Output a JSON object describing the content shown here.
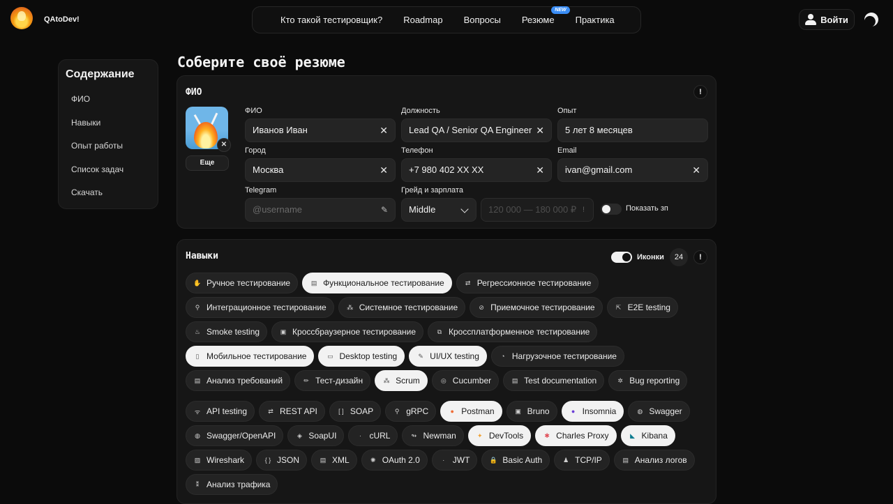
{
  "brand": "QAtoDev!",
  "nav": [
    {
      "label": "Кто такой тестировщик?"
    },
    {
      "label": "Roadmap"
    },
    {
      "label": "Вопросы"
    },
    {
      "label": "Резюме",
      "badge": "NEW"
    },
    {
      "label": "Практика"
    }
  ],
  "login_label": "Войти",
  "sidebar": {
    "title": "Содержание",
    "items": [
      "ФИО",
      "Навыки",
      "Опыт работы",
      "Список задач",
      "Скачать"
    ]
  },
  "page_title": "Соберите своё резюме",
  "fio": {
    "title": "ФИО",
    "info": "!",
    "more_label": "Еще",
    "avatar_remove": "✕",
    "fields": {
      "name": {
        "label": "ФИО",
        "value": "Иванов Иван"
      },
      "position": {
        "label": "Должность",
        "value": "Lead QA / Senior QA Engineer"
      },
      "experience": {
        "label": "Опыт",
        "value": "5 лет 8 месяцев"
      },
      "city": {
        "label": "Город",
        "value": "Москва"
      },
      "phone": {
        "label": "Телефон",
        "value": "+7 980 402 XX XX"
      },
      "email": {
        "label": "Email",
        "value": "ivan@gmail.com"
      },
      "telegram": {
        "label": "Telegram",
        "placeholder": "@username"
      },
      "grade": {
        "label": "Грейд и зарплата",
        "value": "Middle"
      },
      "salary": {
        "placeholder": "120 000 — 180 000 ₽"
      }
    },
    "show_salary_label": "Показать зп",
    "show_salary": false
  },
  "skills": {
    "title": "Навыки",
    "icons_label": "Иконки",
    "icons_on": true,
    "count": "24",
    "info": "!",
    "rows_a": [
      [
        {
          "label": "Ручное тестирование",
          "icon": "✋",
          "selected": false
        },
        {
          "label": "Функциональное тестирование",
          "icon": "▤",
          "selected": true
        },
        {
          "label": "Регрессионное тестирование",
          "icon": "⇄",
          "selected": false
        }
      ],
      [
        {
          "label": "Интеграционное тестирование",
          "icon": "⚲",
          "selected": false
        },
        {
          "label": "Системное тестирование",
          "icon": "⁂",
          "selected": false
        },
        {
          "label": "Приемочное тестирование",
          "icon": "⊘",
          "selected": false
        },
        {
          "label": "E2E testing",
          "icon": "⇱",
          "selected": false
        }
      ],
      [
        {
          "label": "Smoke testing",
          "icon": "♨",
          "selected": false
        },
        {
          "label": "Кроссбраузерное тестирование",
          "icon": "▣",
          "selected": false
        },
        {
          "label": "Кроссплатформенное тестирование",
          "icon": "⧉",
          "selected": false
        }
      ],
      [
        {
          "label": "Мобильное тестирование",
          "icon": "▯",
          "selected": true
        },
        {
          "label": "Desktop testing",
          "icon": "▭",
          "selected": true
        },
        {
          "label": "UI/UX testing",
          "icon": "✎",
          "selected": true
        },
        {
          "label": "Нагрузочное тестирование",
          "icon": "◔",
          "selected": false
        }
      ],
      [
        {
          "label": "Анализ требований",
          "icon": "▤",
          "selected": false
        },
        {
          "label": "Тест-дизайн",
          "icon": "✏",
          "selected": false
        },
        {
          "label": "Scrum",
          "icon": "⁂",
          "selected": true
        },
        {
          "label": "Cucumber",
          "icon": "◎",
          "selected": false
        },
        {
          "label": "Test documentation",
          "icon": "▤",
          "selected": false
        },
        {
          "label": "Bug reporting",
          "icon": "✲",
          "selected": false
        }
      ]
    ],
    "rows_b": [
      [
        {
          "label": "API testing",
          "icon": "ᯤ",
          "selected": false
        },
        {
          "label": "REST API",
          "icon": "⇄",
          "selected": false
        },
        {
          "label": "SOAP",
          "icon": "[ ]",
          "selected": false
        },
        {
          "label": "gRPC",
          "icon": "⚲",
          "selected": false
        },
        {
          "label": "Postman",
          "icon": "●",
          "selected": true,
          "color": "#ef6c35"
        },
        {
          "label": "Bruno",
          "icon": "▣",
          "selected": false
        },
        {
          "label": "Insomnia",
          "icon": "●",
          "selected": true,
          "color": "#6b3fd6"
        },
        {
          "label": "Swagger",
          "icon": "◍",
          "selected": false
        }
      ],
      [
        {
          "label": "Swagger/OpenAPI",
          "icon": "◍",
          "selected": false
        },
        {
          "label": "SoapUI",
          "icon": "◈",
          "selected": false
        },
        {
          "label": "cURL",
          "icon": "·",
          "selected": false
        },
        {
          "label": "Newman",
          "icon": "↬",
          "selected": false
        },
        {
          "label": "DevTools",
          "icon": "✦",
          "selected": true,
          "color": "#f0a030"
        },
        {
          "label": "Charles Proxy",
          "icon": "✱",
          "selected": true,
          "color": "#e0505a"
        },
        {
          "label": "Kibana",
          "icon": "◣",
          "selected": true,
          "color": "#0a7b8f"
        }
      ],
      [
        {
          "label": "Wireshark",
          "icon": "▨",
          "selected": false
        },
        {
          "label": "JSON",
          "icon": "{ }",
          "selected": false
        },
        {
          "label": "XML",
          "icon": "▤",
          "selected": false
        },
        {
          "label": "OAuth 2.0",
          "icon": "✺",
          "selected": false
        },
        {
          "label": "JWT",
          "icon": "·",
          "selected": false
        },
        {
          "label": "Basic Auth",
          "icon": "🔒",
          "selected": false
        },
        {
          "label": "TCP/IP",
          "icon": "♟",
          "selected": false
        },
        {
          "label": "Анализ логов",
          "icon": "▤",
          "selected": false
        }
      ],
      [
        {
          "label": "Анализ трафика",
          "icon": "⁑",
          "selected": false
        }
      ]
    ]
  }
}
